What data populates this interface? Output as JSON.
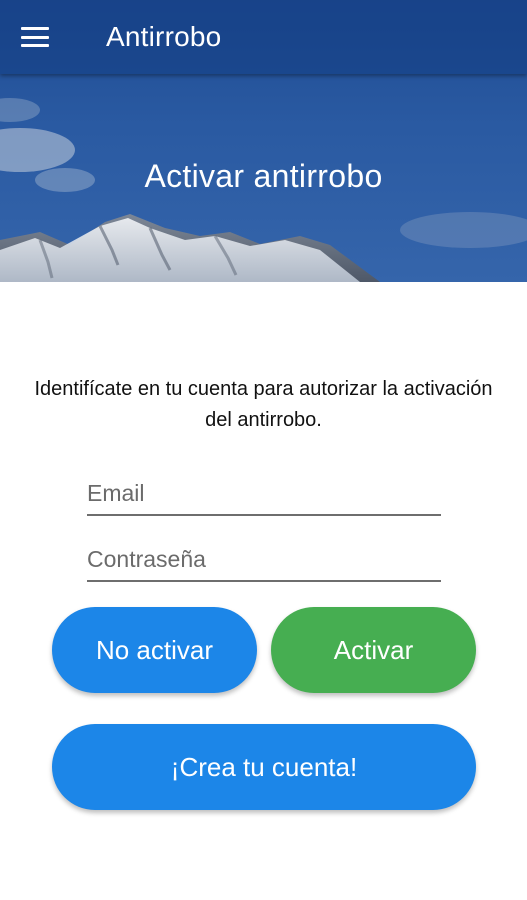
{
  "appbar": {
    "title": "Antirrobo",
    "menu_icon": "hamburger-menu-icon"
  },
  "hero": {
    "title": "Activar antirrobo"
  },
  "form": {
    "instructions": "Identifícate en tu cuenta para autorizar la activación del antirrobo.",
    "email_placeholder": "Email",
    "password_placeholder": "Contraseña"
  },
  "buttons": {
    "no_activate": "No activar",
    "activate": "Activar",
    "create_account": "¡Crea tu cuenta!"
  },
  "colors": {
    "primary_blue": "#1c86e8",
    "activate_green": "#46ae51",
    "hero_blue": "#2a5aa2"
  }
}
